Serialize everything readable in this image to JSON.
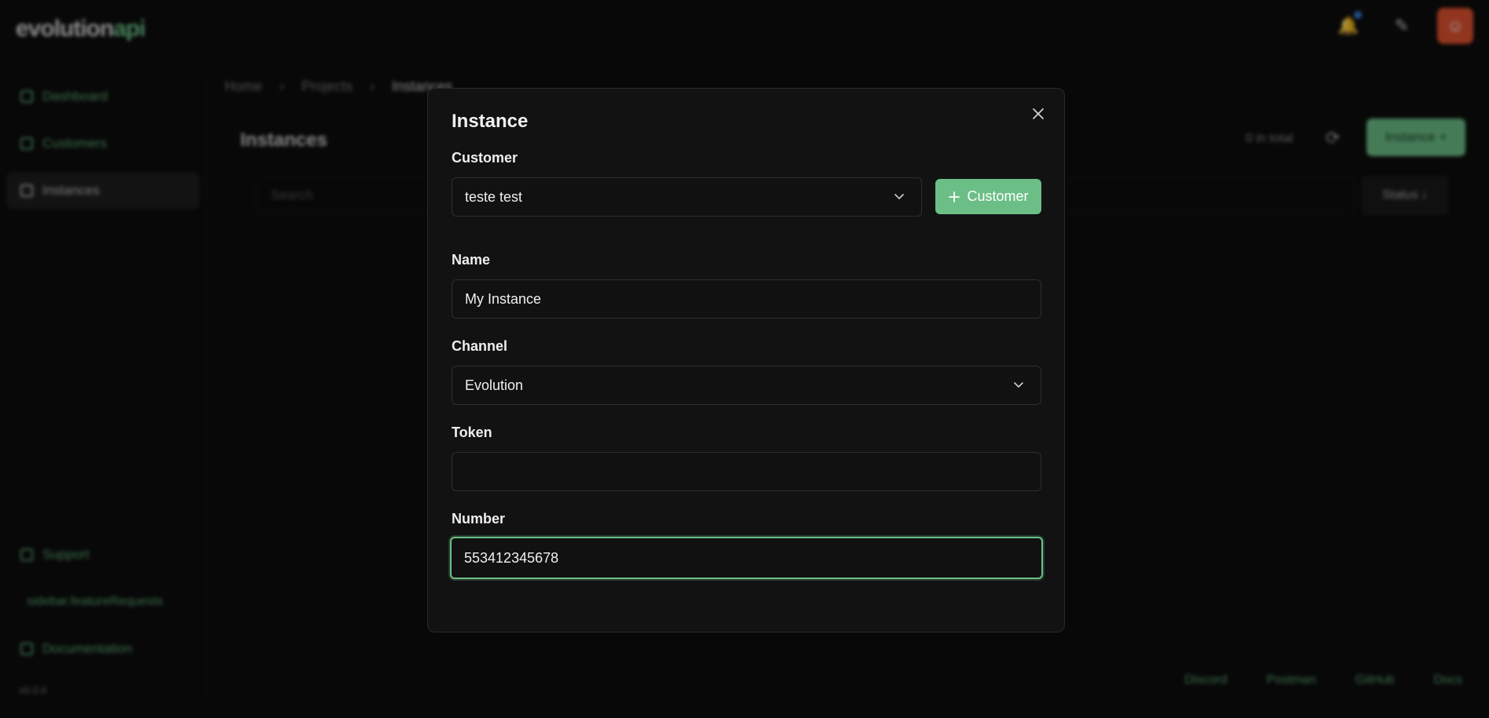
{
  "app": {
    "logo_part1": "evolution",
    "logo_part2": "api",
    "breadcrumbs": [
      "Home",
      "Projects",
      "Instances"
    ],
    "page_title": "Instances",
    "total_text": "0 in total",
    "new_button": "Instance +",
    "search_placeholder": "Search",
    "status_button": "Status ↓",
    "sidebar": {
      "items": [
        "Dashboard",
        "Customers",
        "Instances"
      ],
      "bottom": [
        "Support",
        "Documentation"
      ],
      "feature_link": "sidebar.featureRequests",
      "version": "v0.0.0"
    },
    "footer_links": [
      "Discord",
      "Postman",
      "GitHub",
      "Docs"
    ]
  },
  "modal": {
    "title": "Instance",
    "customer_label": "Customer",
    "customer_value": "teste test",
    "add_customer_label": "Customer",
    "name_label": "Name",
    "name_value": "My Instance",
    "channel_label": "Channel",
    "channel_value": "Evolution",
    "token_label": "Token",
    "token_value": "",
    "number_label": "Number",
    "number_value": "553412345678"
  },
  "colors": {
    "accent": "#6bbf86",
    "background": "#0d0d0d",
    "modal_bg": "#121212",
    "avatar": "#e0522f"
  }
}
